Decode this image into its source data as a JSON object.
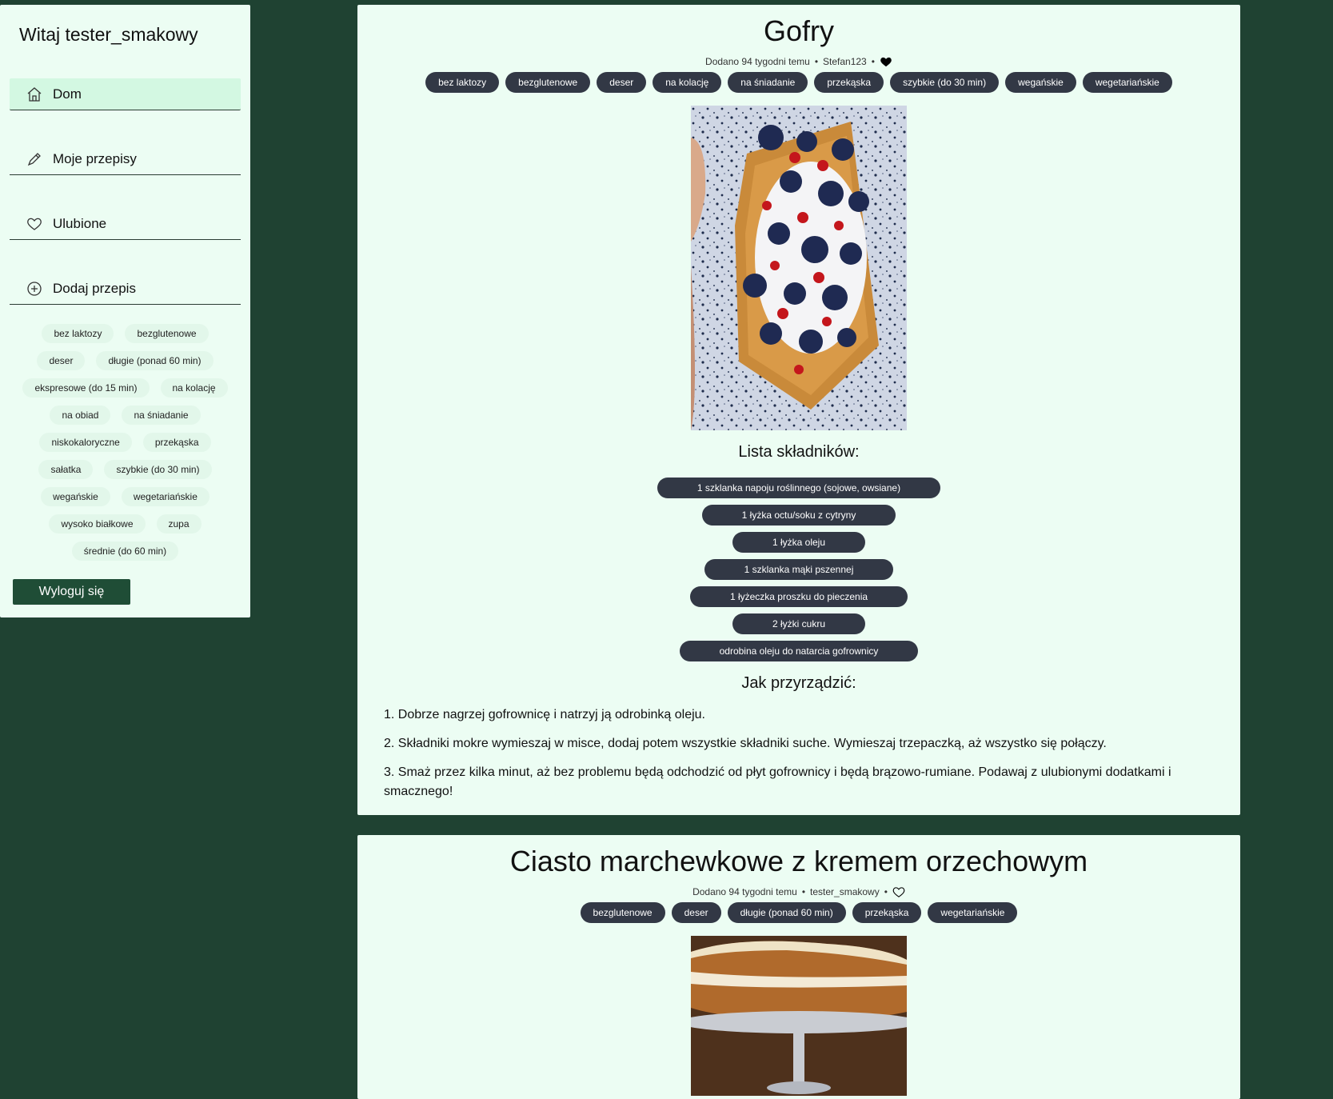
{
  "sidebar": {
    "welcome": "Witaj tester_smakowy",
    "nav": [
      {
        "label": "Dom",
        "icon": "home-icon"
      },
      {
        "label": "Moje przepisy",
        "icon": "pencil-icon"
      },
      {
        "label": "Ulubione",
        "icon": "heart-icon"
      },
      {
        "label": "Dodaj przepis",
        "icon": "plus-circle-icon"
      }
    ],
    "tags": [
      "bez laktozy",
      "bezglutenowe",
      "deser",
      "długie (ponad 60 min)",
      "ekspresowe (do 15 min)",
      "na kolację",
      "na obiad",
      "na śniadanie",
      "niskokaloryczne",
      "przekąska",
      "sałatka",
      "szybkie (do 30 min)",
      "wegańskie",
      "wegetariańskie",
      "wysoko białkowe",
      "zupa",
      "średnie (do 60 min)"
    ],
    "logout": "Wyloguj się"
  },
  "recipes": [
    {
      "title": "Gofry",
      "added": "Dodano 94 tygodni temu",
      "author": "Stefan123",
      "favorite": true,
      "tags": [
        "bez laktozy",
        "bezglutenowe",
        "deser",
        "na kolację",
        "na śniadanie",
        "przekąska",
        "szybkie (do 30 min)",
        "wegańskie",
        "wegetariańskie"
      ],
      "ingredients_title": "Lista składników:",
      "ingredients": [
        "1 szklanka napoju roślinnego (sojowe, owsiane)",
        "1 łyżka octu/soku z cytryny",
        "1 łyżka oleju",
        "1 szklanka mąki pszennej",
        "1 łyżeczka proszku do pieczenia",
        "2 łyżki cukru",
        "odrobina oleju do natarcia gofrownicy"
      ],
      "steps_title": "Jak przyrządzić:",
      "steps": [
        "1. Dobrze nagrzej gofrownicę i natrzyj ją odrobinką oleju.",
        "2. Składniki mokre wymieszaj w misce, dodaj potem wszystkie składniki suche. Wymieszaj trzepaczką, aż wszystko się połączy.",
        "3. Smaż przez kilka minut, aż bez problemu będą odchodzić od płyt gofrownicy i będą brązowo-rumiane. Podawaj z ulubionymi dodatkami i smacznego!"
      ]
    },
    {
      "title": "Ciasto marchewkowe z kremem orzechowym",
      "added": "Dodano 94 tygodni temu",
      "author": "tester_smakowy",
      "favorite": false,
      "tags": [
        "bezglutenowe",
        "deser",
        "długie (ponad 60 min)",
        "przekąska",
        "wegetariańskie"
      ]
    }
  ],
  "colors": {
    "background": "#1f4232",
    "panel": "#ecfdf3",
    "tag": "#323845",
    "active_nav": "#d3f8e2",
    "logout": "#1f4d36"
  }
}
